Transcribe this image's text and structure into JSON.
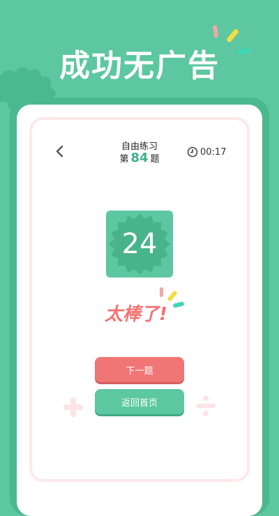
{
  "promo": {
    "headline": "成功无广告"
  },
  "header": {
    "title": "自由练习",
    "counter_prefix": "第",
    "counter_value": "84",
    "counter_suffix": "题",
    "timer": "00:17"
  },
  "result": {
    "value": "24",
    "praise": "太棒了!"
  },
  "buttons": {
    "next": "下一题",
    "home": "返回首页"
  },
  "icons": {
    "back": "chevron-left-icon",
    "timer": "clock-icon"
  },
  "colors": {
    "background": "#5cc7a0",
    "accent": "#3fae8c",
    "praise": "#f27373",
    "next_button": "#f07676",
    "home_button": "#5cc7a0"
  }
}
